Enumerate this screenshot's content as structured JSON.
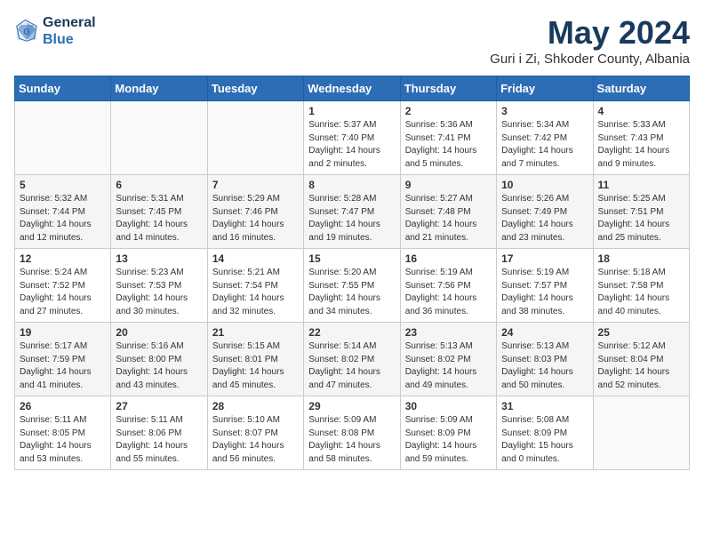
{
  "header": {
    "logo_line1": "General",
    "logo_line2": "Blue",
    "month_title": "May 2024",
    "location": "Guri i Zi, Shkoder County, Albania"
  },
  "weekdays": [
    "Sunday",
    "Monday",
    "Tuesday",
    "Wednesday",
    "Thursday",
    "Friday",
    "Saturday"
  ],
  "weeks": [
    [
      {
        "day": "",
        "info": ""
      },
      {
        "day": "",
        "info": ""
      },
      {
        "day": "",
        "info": ""
      },
      {
        "day": "1",
        "info": "Sunrise: 5:37 AM\nSunset: 7:40 PM\nDaylight: 14 hours\nand 2 minutes."
      },
      {
        "day": "2",
        "info": "Sunrise: 5:36 AM\nSunset: 7:41 PM\nDaylight: 14 hours\nand 5 minutes."
      },
      {
        "day": "3",
        "info": "Sunrise: 5:34 AM\nSunset: 7:42 PM\nDaylight: 14 hours\nand 7 minutes."
      },
      {
        "day": "4",
        "info": "Sunrise: 5:33 AM\nSunset: 7:43 PM\nDaylight: 14 hours\nand 9 minutes."
      }
    ],
    [
      {
        "day": "5",
        "info": "Sunrise: 5:32 AM\nSunset: 7:44 PM\nDaylight: 14 hours\nand 12 minutes."
      },
      {
        "day": "6",
        "info": "Sunrise: 5:31 AM\nSunset: 7:45 PM\nDaylight: 14 hours\nand 14 minutes."
      },
      {
        "day": "7",
        "info": "Sunrise: 5:29 AM\nSunset: 7:46 PM\nDaylight: 14 hours\nand 16 minutes."
      },
      {
        "day": "8",
        "info": "Sunrise: 5:28 AM\nSunset: 7:47 PM\nDaylight: 14 hours\nand 19 minutes."
      },
      {
        "day": "9",
        "info": "Sunrise: 5:27 AM\nSunset: 7:48 PM\nDaylight: 14 hours\nand 21 minutes."
      },
      {
        "day": "10",
        "info": "Sunrise: 5:26 AM\nSunset: 7:49 PM\nDaylight: 14 hours\nand 23 minutes."
      },
      {
        "day": "11",
        "info": "Sunrise: 5:25 AM\nSunset: 7:51 PM\nDaylight: 14 hours\nand 25 minutes."
      }
    ],
    [
      {
        "day": "12",
        "info": "Sunrise: 5:24 AM\nSunset: 7:52 PM\nDaylight: 14 hours\nand 27 minutes."
      },
      {
        "day": "13",
        "info": "Sunrise: 5:23 AM\nSunset: 7:53 PM\nDaylight: 14 hours\nand 30 minutes."
      },
      {
        "day": "14",
        "info": "Sunrise: 5:21 AM\nSunset: 7:54 PM\nDaylight: 14 hours\nand 32 minutes."
      },
      {
        "day": "15",
        "info": "Sunrise: 5:20 AM\nSunset: 7:55 PM\nDaylight: 14 hours\nand 34 minutes."
      },
      {
        "day": "16",
        "info": "Sunrise: 5:19 AM\nSunset: 7:56 PM\nDaylight: 14 hours\nand 36 minutes."
      },
      {
        "day": "17",
        "info": "Sunrise: 5:19 AM\nSunset: 7:57 PM\nDaylight: 14 hours\nand 38 minutes."
      },
      {
        "day": "18",
        "info": "Sunrise: 5:18 AM\nSunset: 7:58 PM\nDaylight: 14 hours\nand 40 minutes."
      }
    ],
    [
      {
        "day": "19",
        "info": "Sunrise: 5:17 AM\nSunset: 7:59 PM\nDaylight: 14 hours\nand 41 minutes."
      },
      {
        "day": "20",
        "info": "Sunrise: 5:16 AM\nSunset: 8:00 PM\nDaylight: 14 hours\nand 43 minutes."
      },
      {
        "day": "21",
        "info": "Sunrise: 5:15 AM\nSunset: 8:01 PM\nDaylight: 14 hours\nand 45 minutes."
      },
      {
        "day": "22",
        "info": "Sunrise: 5:14 AM\nSunset: 8:02 PM\nDaylight: 14 hours\nand 47 minutes."
      },
      {
        "day": "23",
        "info": "Sunrise: 5:13 AM\nSunset: 8:02 PM\nDaylight: 14 hours\nand 49 minutes."
      },
      {
        "day": "24",
        "info": "Sunrise: 5:13 AM\nSunset: 8:03 PM\nDaylight: 14 hours\nand 50 minutes."
      },
      {
        "day": "25",
        "info": "Sunrise: 5:12 AM\nSunset: 8:04 PM\nDaylight: 14 hours\nand 52 minutes."
      }
    ],
    [
      {
        "day": "26",
        "info": "Sunrise: 5:11 AM\nSunset: 8:05 PM\nDaylight: 14 hours\nand 53 minutes."
      },
      {
        "day": "27",
        "info": "Sunrise: 5:11 AM\nSunset: 8:06 PM\nDaylight: 14 hours\nand 55 minutes."
      },
      {
        "day": "28",
        "info": "Sunrise: 5:10 AM\nSunset: 8:07 PM\nDaylight: 14 hours\nand 56 minutes."
      },
      {
        "day": "29",
        "info": "Sunrise: 5:09 AM\nSunset: 8:08 PM\nDaylight: 14 hours\nand 58 minutes."
      },
      {
        "day": "30",
        "info": "Sunrise: 5:09 AM\nSunset: 8:09 PM\nDaylight: 14 hours\nand 59 minutes."
      },
      {
        "day": "31",
        "info": "Sunrise: 5:08 AM\nSunset: 8:09 PM\nDaylight: 15 hours\nand 0 minutes."
      },
      {
        "day": "",
        "info": ""
      }
    ]
  ]
}
